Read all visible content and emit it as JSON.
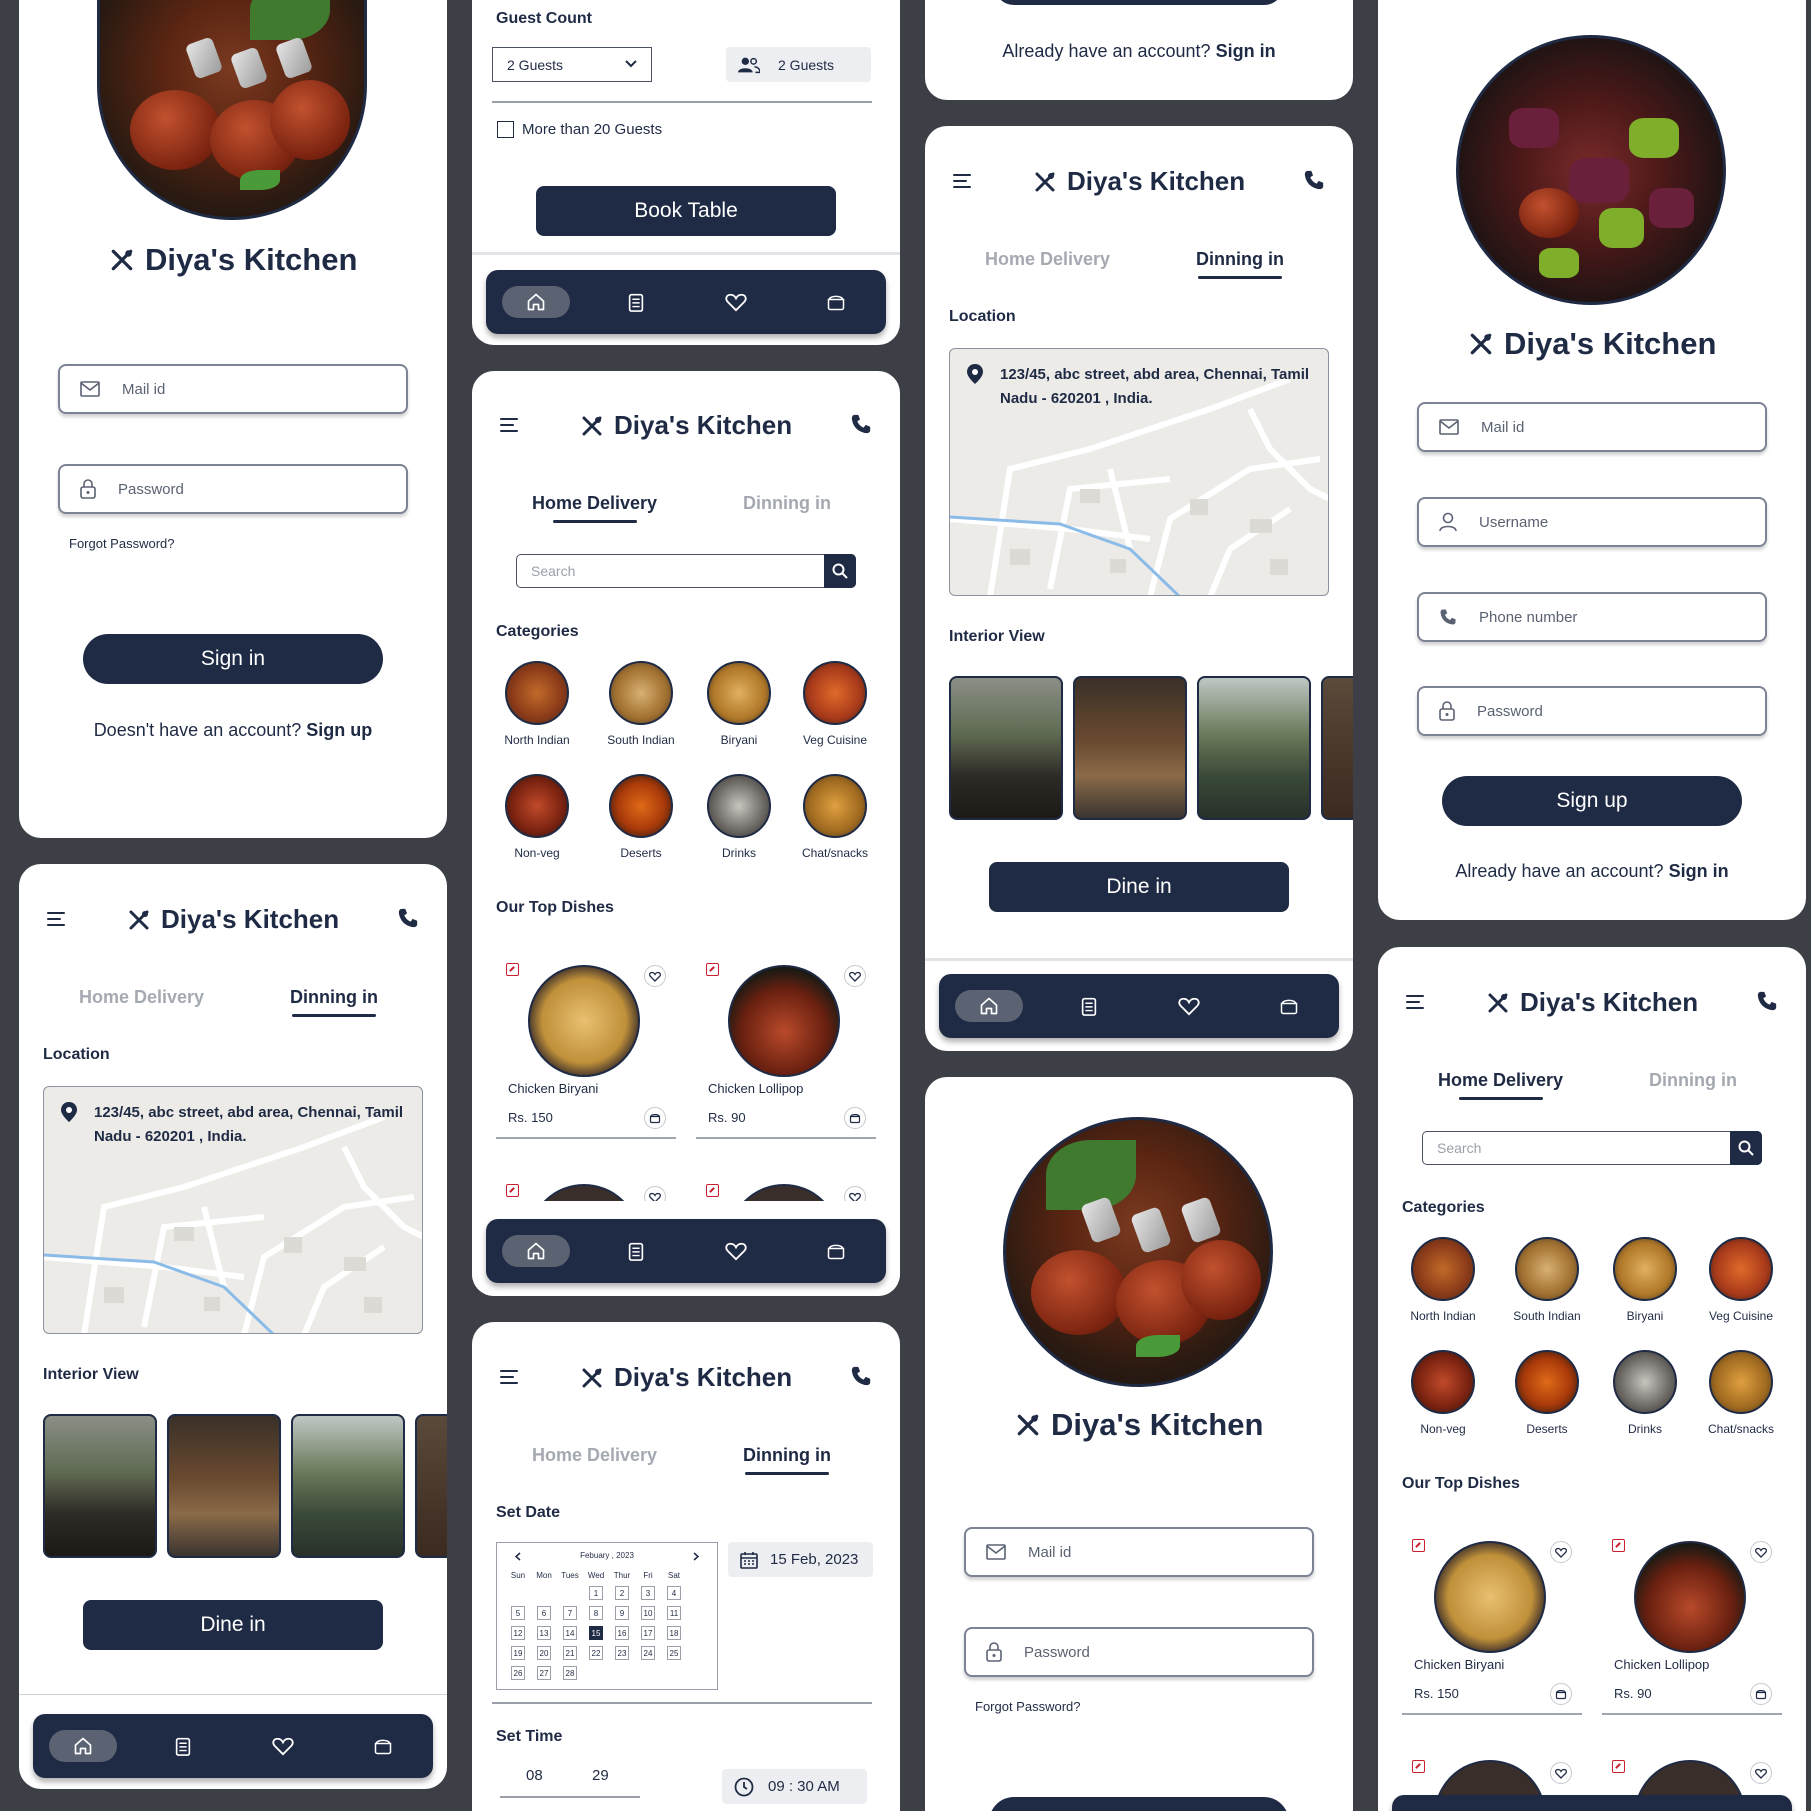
{
  "brand": {
    "name": "Diya's Kitchen"
  },
  "signin": {
    "mail_placeholder": "Mail id",
    "password_placeholder": "Password",
    "forgot": "Forgot Password?",
    "button": "Sign in",
    "footer_prefix": "Doesn't have an account?",
    "footer_link": "Sign up"
  },
  "signup": {
    "mail_placeholder": "Mail id",
    "username_placeholder": "Username",
    "phone_placeholder": "Phone number",
    "password_placeholder": "Password",
    "button": "Sign up",
    "footer_prefix": "Already have an account?",
    "footer_link": "Sign in"
  },
  "tabs": {
    "home": "Home Delivery",
    "dine": "Dinning in"
  },
  "home": {
    "search_placeholder": "Search",
    "categories_title": "Categories",
    "categories": [
      "North Indian",
      "South Indian",
      "Biryani",
      "Veg Cuisine",
      "Non-veg",
      "Deserts",
      "Drinks",
      "Chat/snacks"
    ],
    "top_title": "Our Top Dishes",
    "dishes": [
      {
        "name": "Chicken Biryani",
        "price": "Rs. 150"
      },
      {
        "name": "Chicken Lollipop",
        "price": "Rs. 90"
      }
    ]
  },
  "dine": {
    "location_title": "Location",
    "address": "123/45, abc street, abd area, Chennai, Tamil Nadu - 620201 , India.",
    "interior_title": "Interior View",
    "button": "Dine in"
  },
  "booking": {
    "set_date": "Set Date",
    "month": "Febuary",
    "year": "2023",
    "weekdays": [
      "Sun",
      "Mon",
      "Tues",
      "Wed",
      "Thur",
      "Fri",
      "Sat"
    ],
    "selected_day": 15,
    "date_value": "15 Feb, 2023",
    "set_time": "Set Time",
    "hour": "08",
    "minute": "29",
    "time_value": "09 : 30 AM",
    "guest_title": "Guest Count",
    "guest_select": "2 Guests",
    "guest_chip": "2 Guests",
    "more_guests": "More than 20 Guests",
    "button": "Book Table"
  },
  "colors": {
    "navy": "#1f2a44",
    "muted": "#a5a9b1",
    "bg": "#3c3f46",
    "tag": "#c8202f"
  },
  "icons": [
    "menu-icon",
    "phone-icon",
    "cutlery-icon",
    "home-icon",
    "orders-icon",
    "heart-icon",
    "cart-icon",
    "mail-icon",
    "lock-icon",
    "user-icon",
    "search-icon",
    "pin-icon",
    "calendar-icon",
    "clock-icon",
    "guests-icon"
  ]
}
